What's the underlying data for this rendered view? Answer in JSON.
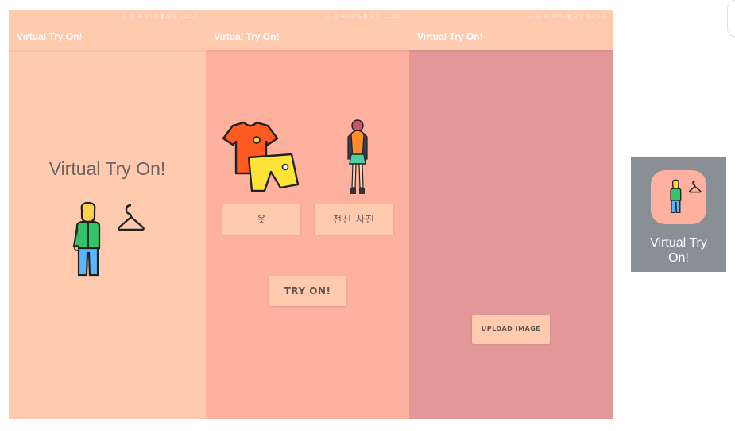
{
  "status": {
    "text": "⚠ ◎ ✈ 34% ▮ 오후 12:58"
  },
  "app": {
    "title": "Virtual Try On!"
  },
  "screen1": {
    "headline": "Virtual Try On!"
  },
  "screen2": {
    "clothes_button": "옷",
    "photo_button": "전신 사진",
    "tryon_button": "TRY ON!"
  },
  "screen3": {
    "upload_button": "UPLOAD IMAGE"
  },
  "launcher": {
    "label_line1": "Virtual Try",
    "label_line2": "On!"
  },
  "icons": [
    "person-icon",
    "hanger-icon",
    "tshirt-icon",
    "shorts-icon",
    "model-figure-icon"
  ],
  "colors": {
    "peach": "#ffcaae",
    "salmon": "#ffb1a0",
    "rose": "#e49799",
    "tile_gray": "#8a8f96"
  }
}
